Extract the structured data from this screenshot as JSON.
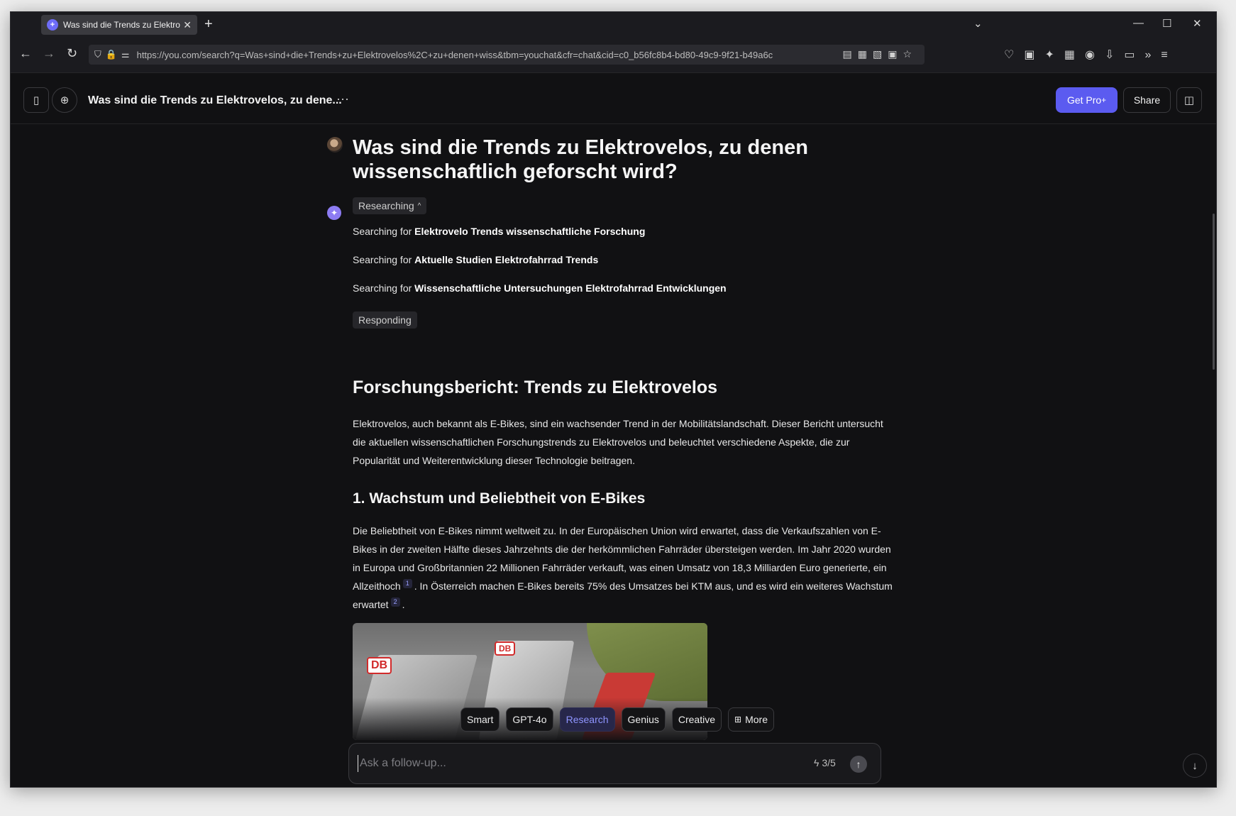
{
  "browser": {
    "tab_title": "Was sind die Trends zu Elektrovelos, zu denen wiss",
    "tab_favicon": "+",
    "url": "https://you.com/search?q=Was+sind+die+Trends+zu+Elektrovelos%2C+zu+denen+wiss&tbm=youchat&cfr=chat&cid=c0_b56fc8b4-bd80-49c9-9f21-b49a6c"
  },
  "header": {
    "title": "Was sind die Trends zu Elektrovelos, zu dene...",
    "get_pro": "Get Pro",
    "get_pro_sup": "+",
    "share": "Share"
  },
  "chat": {
    "question": "Was sind die Trends zu Elektrovelos, zu denen wissenschaftlich geforscht wird?",
    "researching_label": "Researching",
    "searching_prefix": "Searching for",
    "searches": [
      "Elektrovelo Trends wissenschaftliche Forschung",
      "Aktuelle Studien Elektrofahrrad Trends",
      "Wissenschaftliche Untersuchungen Elektrofahrrad Entwicklungen"
    ],
    "responding_label": "Responding",
    "report_title": "Forschungsbericht: Trends zu Elektrovelos",
    "intro": "Elektrovelos, auch bekannt als E-Bikes, sind ein wachsender Trend in der Mobilitätslandschaft. Dieser Bericht untersucht die aktuellen wissenschaftlichen Forschungstrends zu Elektrovelos und beleuchtet verschiedene Aspekte, die zur Popularität und Weiterentwicklung dieser Technologie beitragen.",
    "section1_title": "1. Wachstum und Beliebtheit von E-Bikes",
    "section1_part1": "Die Beliebtheit von E-Bikes nimmt weltweit zu. In der Europäischen Union wird erwartet, dass die Verkaufszahlen von E-Bikes in der zweiten Hälfte dieses Jahrzehnts die der herkömmlichen Fahrräder übersteigen werden. Im Jahr 2020 wurden in Europa und Großbritannien 22 Millionen Fahrräder verkauft, was einen Umsatz von 18,3 Milliarden Euro generierte, ein Allzeithoch",
    "cite1": "1",
    "section1_part2": ". In Österreich machen E-Bikes bereits 75% des Umsatzes bei KTM aus, und es wird ein weiteres Wachstum erwartet",
    "cite2": "2",
    "section1_part3": ".",
    "image_badge_1": "DB",
    "image_badge_2": "DB"
  },
  "modes": {
    "items": [
      "Smart",
      "GPT-4o",
      "Research",
      "Genius",
      "Creative",
      "More"
    ],
    "active": "Research"
  },
  "input": {
    "placeholder": "Ask a follow-up...",
    "value": "",
    "credits": "3/5"
  },
  "colors": {
    "accent": "#5b5bf0",
    "active_mode_text": "#8f95ff",
    "background": "#111113"
  }
}
